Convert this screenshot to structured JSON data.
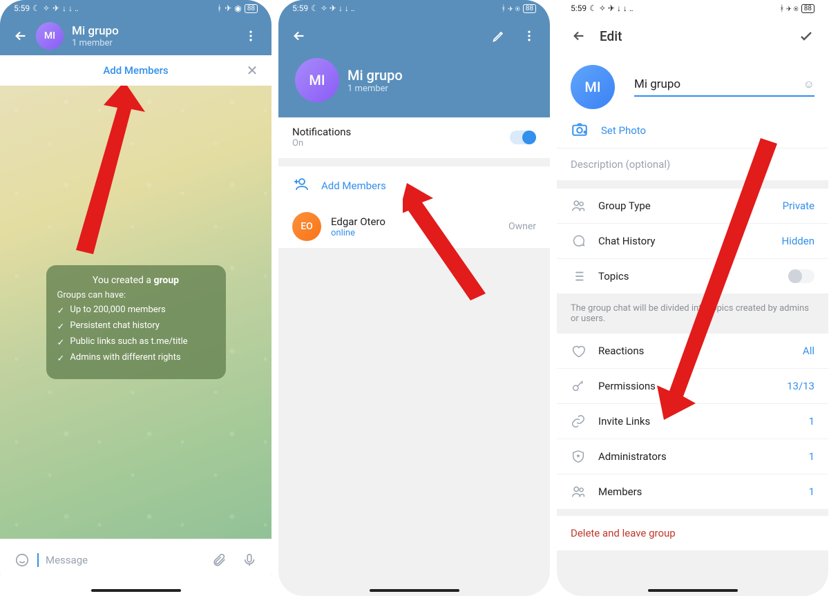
{
  "status": {
    "time": "5:59",
    "battery": "88"
  },
  "screen1": {
    "title": "Mi grupo",
    "subtitle": "1 member",
    "avatar_initials": "MI",
    "add_members": "Add Members",
    "message_placeholder": "Message",
    "bubble": {
      "title_pre": "You created a ",
      "title_bold": "group",
      "subtitle": "Groups can have:",
      "items": [
        "Up to 200,000 members",
        "Persistent chat history",
        "Public links such as t.me/title",
        "Admins with different rights"
      ]
    }
  },
  "screen2": {
    "title": "Mi grupo",
    "subtitle": "1 member",
    "avatar_initials": "MI",
    "notifications_label": "Notifications",
    "notifications_value": "On",
    "add_members": "Add Members",
    "member": {
      "initials": "EO",
      "name": "Edgar Otero",
      "status": "online",
      "role": "Owner"
    }
  },
  "screen3": {
    "header_title": "Edit",
    "avatar_initials": "MI",
    "name": "Mi grupo",
    "set_photo": "Set Photo",
    "description_placeholder": "Description (optional)",
    "rows": {
      "group_type": {
        "label": "Group Type",
        "value": "Private"
      },
      "chat_history": {
        "label": "Chat History",
        "value": "Hidden"
      },
      "topics": {
        "label": "Topics"
      },
      "reactions": {
        "label": "Reactions",
        "value": "All"
      },
      "permissions": {
        "label": "Permissions",
        "value": "13/13"
      },
      "invite_links": {
        "label": "Invite Links",
        "value": "1"
      },
      "administrators": {
        "label": "Administrators",
        "value": "1"
      },
      "members": {
        "label": "Members",
        "value": "1"
      }
    },
    "topics_hint": "The group chat will be divided into topics created by admins or users.",
    "delete_label": "Delete and leave group"
  }
}
